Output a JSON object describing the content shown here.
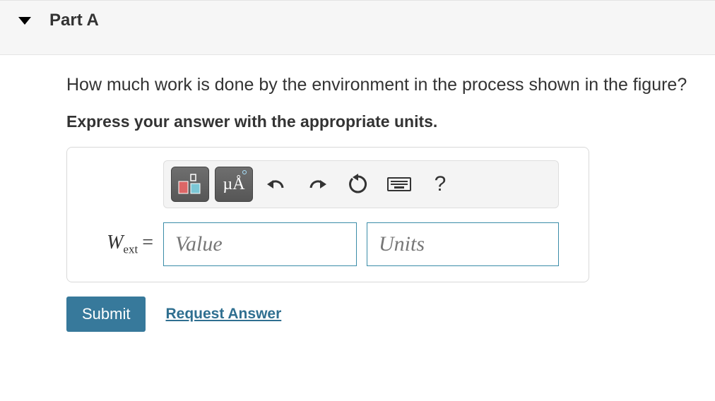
{
  "header": {
    "title": "Part A"
  },
  "question": "How much work is done by the environment in the process shown in the figure?",
  "instruction": "Express your answer with the appropriate units.",
  "toolbar": {
    "units_button_text": "µÅ",
    "help_text": "?"
  },
  "answer": {
    "variable_main": "W",
    "variable_sub": "ext",
    "equals": "=",
    "value_placeholder": "Value",
    "units_placeholder": "Units"
  },
  "actions": {
    "submit": "Submit",
    "request": "Request Answer"
  }
}
